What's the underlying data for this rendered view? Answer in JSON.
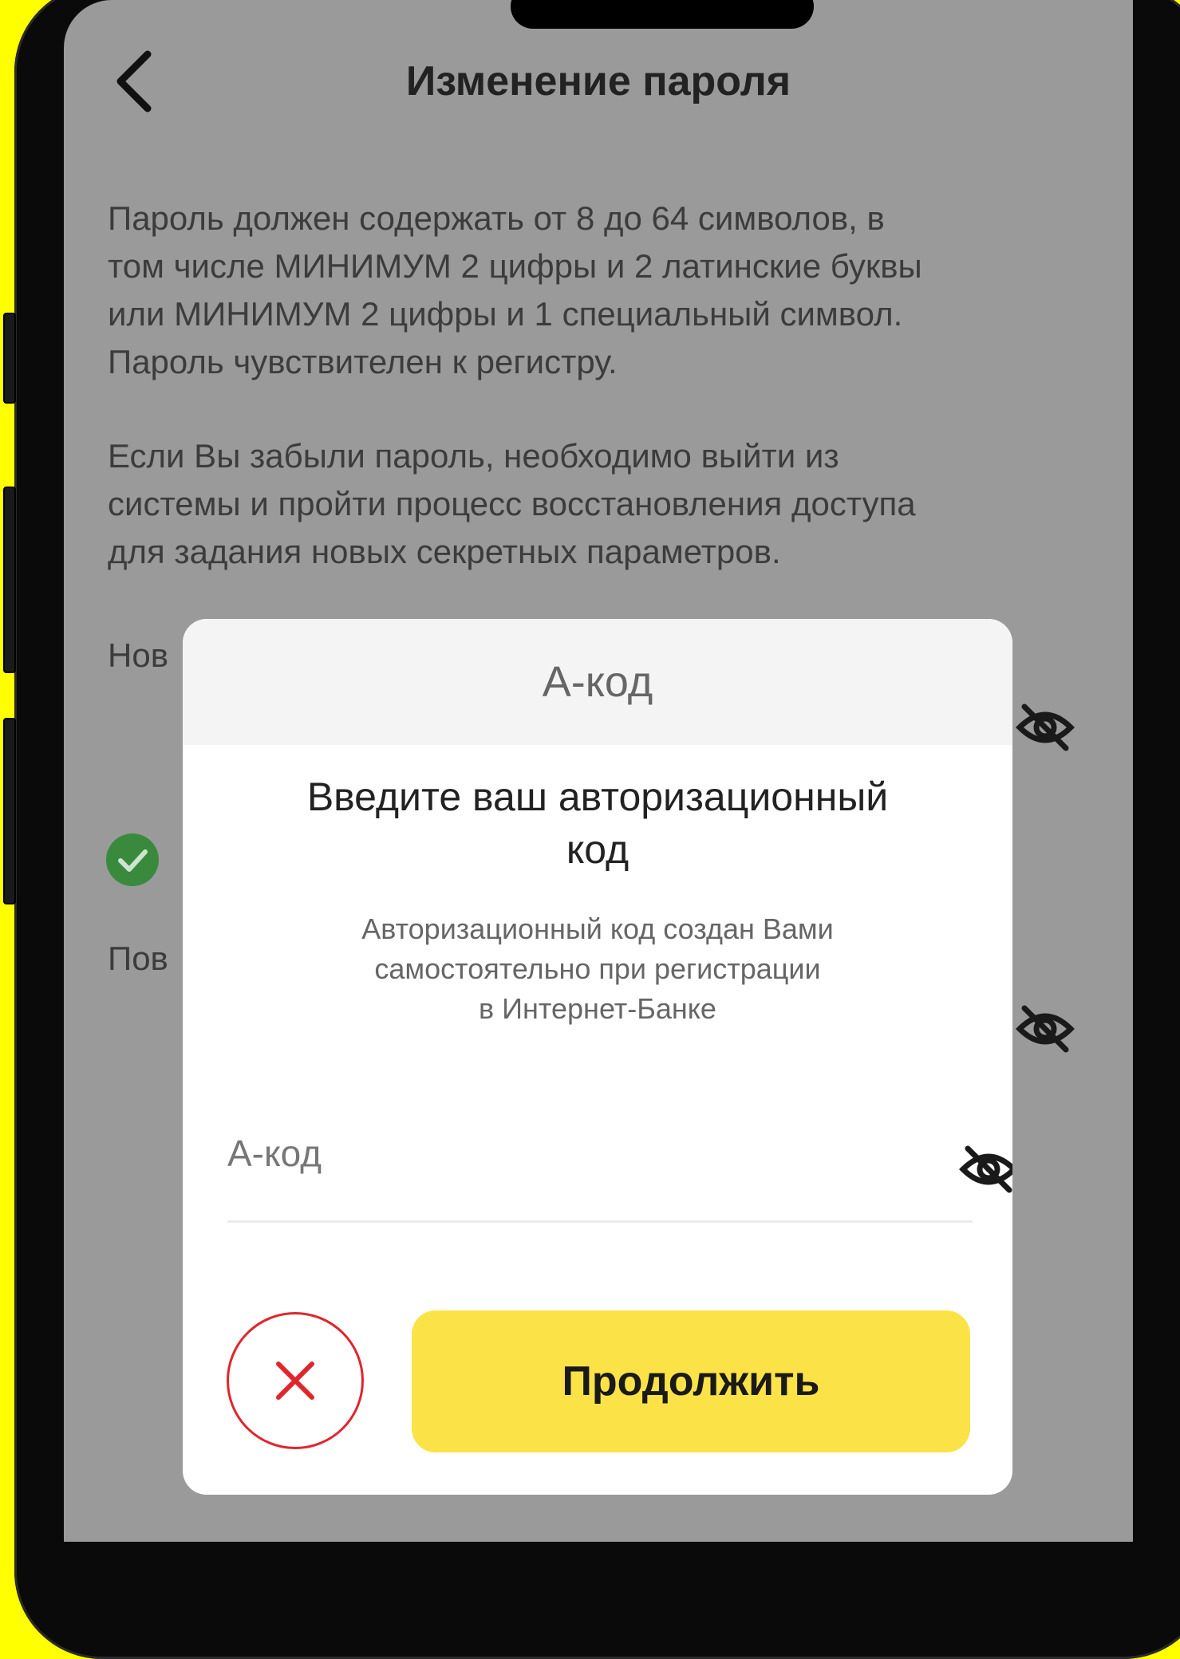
{
  "header": {
    "title": "Изменение пароля"
  },
  "info": {
    "paragraph1_lines": [
      "Пароль должен содержать от 8 до 64 символов, в",
      "том числе МИНИМУМ 2 цифры и 2 латинские буквы",
      "или МИНИМУМ 2 цифры и 1 специальный символ.",
      "Пароль чувствителен к регистру."
    ],
    "paragraph2_lines": [
      "Если Вы забыли пароль, необходимо выйти из",
      "системы и пройти процесс восстановления доступа",
      "для задания новых секретных параметров."
    ]
  },
  "form": {
    "new_password_label_visible": "Нов",
    "repeat_password_label_visible": "Пов"
  },
  "dialog": {
    "header_title": "А-код",
    "heading_line1": "Введите ваш авторизационный",
    "heading_line2": "код",
    "subtitle_line1": "Авторизационный код создан Вами",
    "subtitle_line2": "самостоятельно при регистрации",
    "subtitle_line3": "в Интернет-Банке",
    "input_placeholder": "А-код",
    "input_value": "",
    "continue_label": "Продолжить"
  },
  "icons": {
    "back": "chevron-left-icon",
    "eye_hidden": "eye-off-icon",
    "check": "check-circle-icon",
    "close": "close-icon"
  },
  "colors": {
    "accent_yellow": "#fbe347",
    "cancel_red": "#e0262d",
    "success_green": "#3a8a3e",
    "overlay_gray": "#9a9a9a"
  }
}
